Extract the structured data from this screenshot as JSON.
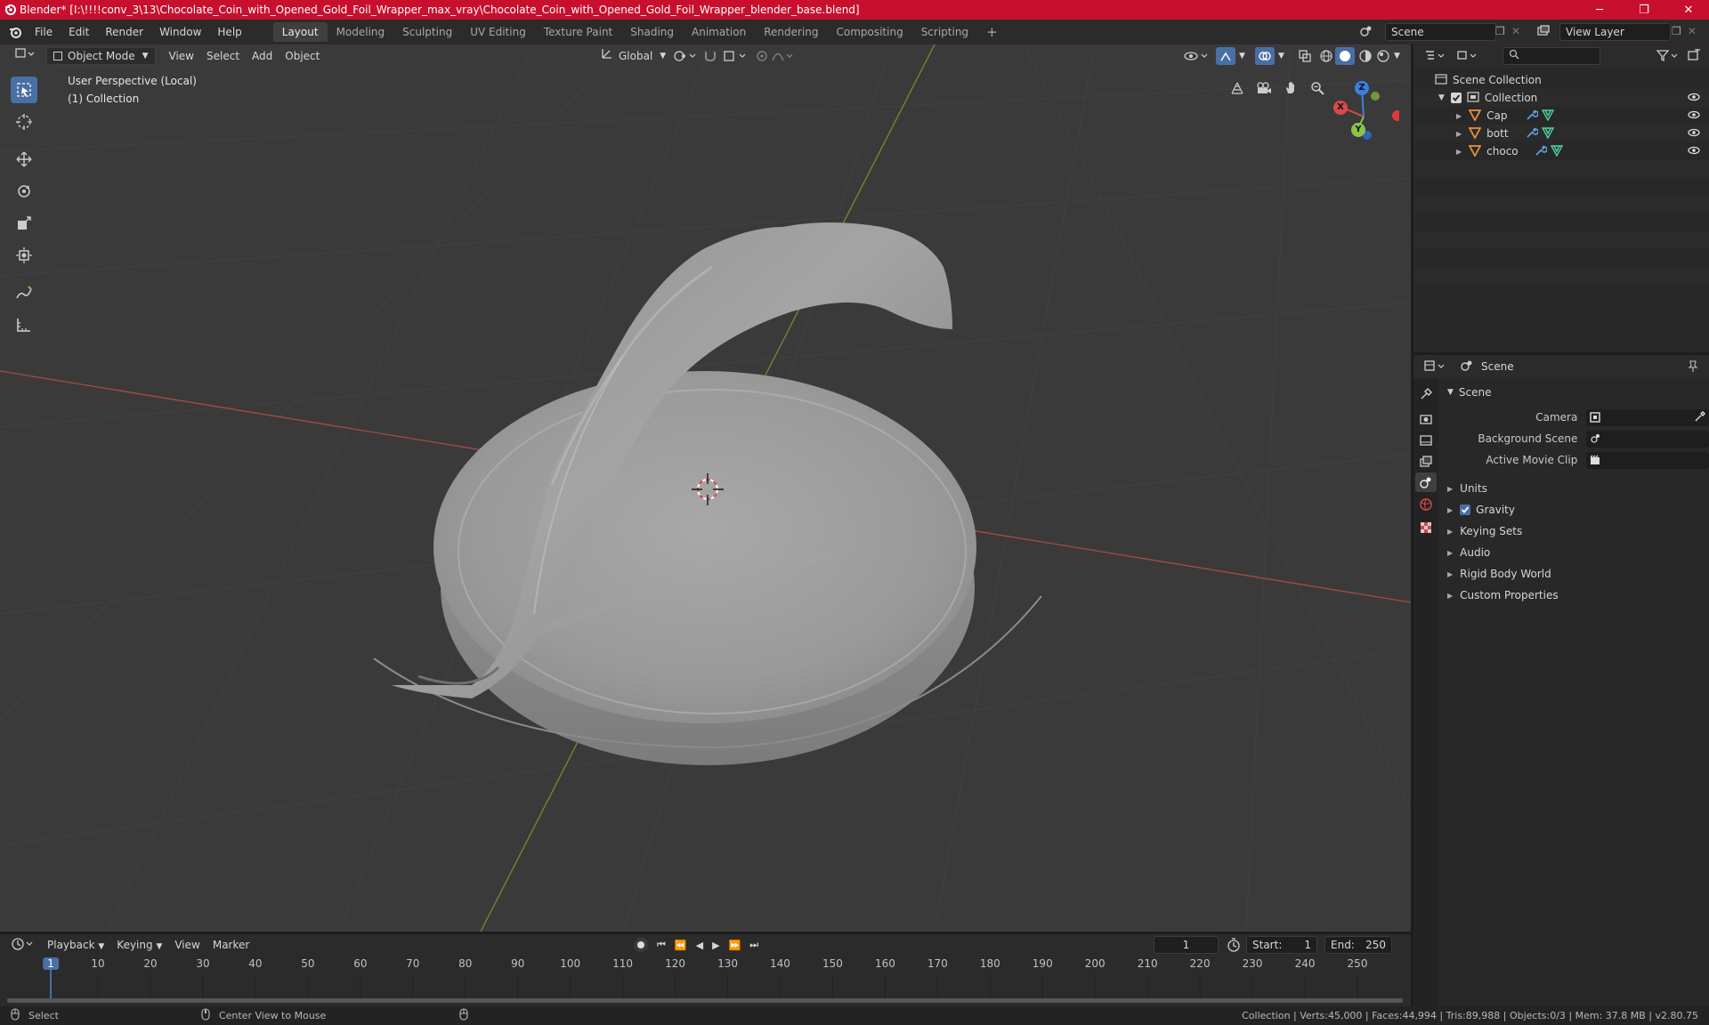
{
  "window": {
    "title": "Blender* [I:\\!!!!conv_3\\13\\Chocolate_Coin_with_Opened_Gold_Foil_Wrapper_max_vray\\Chocolate_Coin_with_Opened_Gold_Foil_Wrapper_blender_base.blend]",
    "minimize": "─",
    "maximize": "❐",
    "close": "✕"
  },
  "menu": [
    "File",
    "Edit",
    "Render",
    "Window",
    "Help"
  ],
  "workspaces": [
    "Layout",
    "Modeling",
    "Sculpting",
    "UV Editing",
    "Texture Paint",
    "Shading",
    "Animation",
    "Rendering",
    "Compositing",
    "Scripting"
  ],
  "active_workspace": "Layout",
  "add_workspace": "+",
  "scene_field": "Scene",
  "view_layer_field": "View Layer",
  "viewport": {
    "mode": "Object Mode",
    "menus": [
      "View",
      "Select",
      "Add",
      "Object"
    ],
    "transform_orientation": "Global",
    "overlay_line1": "User Perspective (Local)",
    "overlay_line2": "(1) Collection",
    "gizmo_labels": {
      "x": "X",
      "y": "Y",
      "z": "Z"
    }
  },
  "outliner": {
    "search_placeholder": "",
    "root": "Scene Collection",
    "collection": "Collection",
    "objects": [
      {
        "name": "Cap"
      },
      {
        "name": "bott"
      },
      {
        "name": "choco"
      }
    ]
  },
  "properties": {
    "header_title": "Scene",
    "panel_title": "Scene",
    "rows": [
      {
        "label": "Camera"
      },
      {
        "label": "Background Scene"
      },
      {
        "label": "Active Movie Clip"
      }
    ],
    "subpanels": [
      "Units",
      "Gravity",
      "Keying Sets",
      "Audio",
      "Rigid Body World",
      "Custom Properties"
    ],
    "gravity_checked": true
  },
  "timeline": {
    "menus": [
      "Playback",
      "Keying",
      "View",
      "Marker"
    ],
    "current_frame": "1",
    "start_label": "Start:",
    "start_value": "1",
    "end_label": "End:",
    "end_value": "250",
    "ticks": [
      1,
      10,
      20,
      30,
      40,
      50,
      60,
      70,
      80,
      90,
      100,
      110,
      120,
      130,
      140,
      150,
      160,
      170,
      180,
      190,
      200,
      210,
      220,
      230,
      240,
      250
    ]
  },
  "status": {
    "select": "Select",
    "center_view": "Center View to Mouse",
    "stats": "Collection | Verts:45,000 | Faces:44,994 | Tris:89,988 | Objects:0/3 | Mem: 37.8 MB | v2.80.75"
  },
  "colors": {
    "titlebar": "#c8102e",
    "accent": "#4a6fa5",
    "object_orange": "#e8913a",
    "modifier_blue": "#5ea7e8",
    "mesh_green": "#4fd1a0",
    "axis_red": "#d94a4a",
    "axis_green": "#8bc34a",
    "axis_blue": "#3d7fe0"
  }
}
